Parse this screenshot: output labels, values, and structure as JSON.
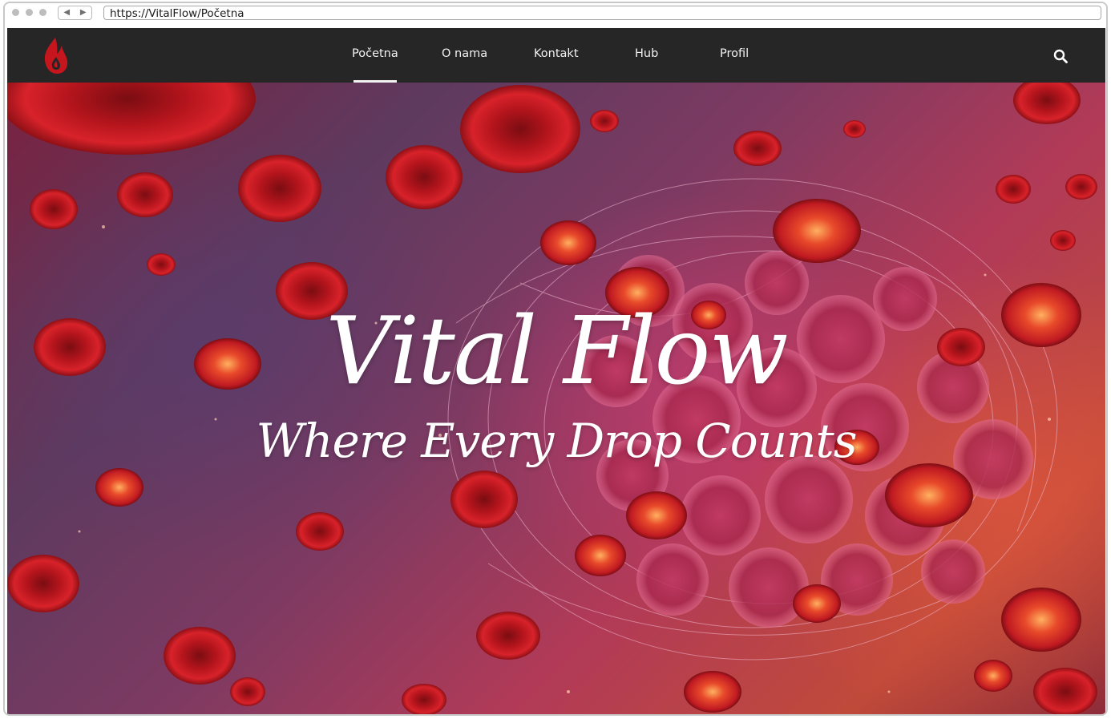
{
  "browser": {
    "url": "https://VitalFlow/Početna",
    "back_glyph": "◀",
    "forward_glyph": "▶"
  },
  "navbar": {
    "logo_icon": "blood-drop-flame-icon",
    "items": [
      {
        "label": "Početna",
        "active": true
      },
      {
        "label": "O nama",
        "active": false
      },
      {
        "label": "Kontakt",
        "active": false
      },
      {
        "label": "Hub",
        "active": false
      },
      {
        "label": "Profil",
        "active": false
      }
    ],
    "search_icon": "search-icon"
  },
  "hero": {
    "title": "Vital Flow",
    "subtitle": "Where Every Drop Counts",
    "background": "red-blood-cells-image"
  },
  "colors": {
    "navbar_bg": "#262626",
    "nav_text": "#f2f2f2",
    "logo_red": "#c4161c",
    "hero_text": "#ffffff"
  }
}
